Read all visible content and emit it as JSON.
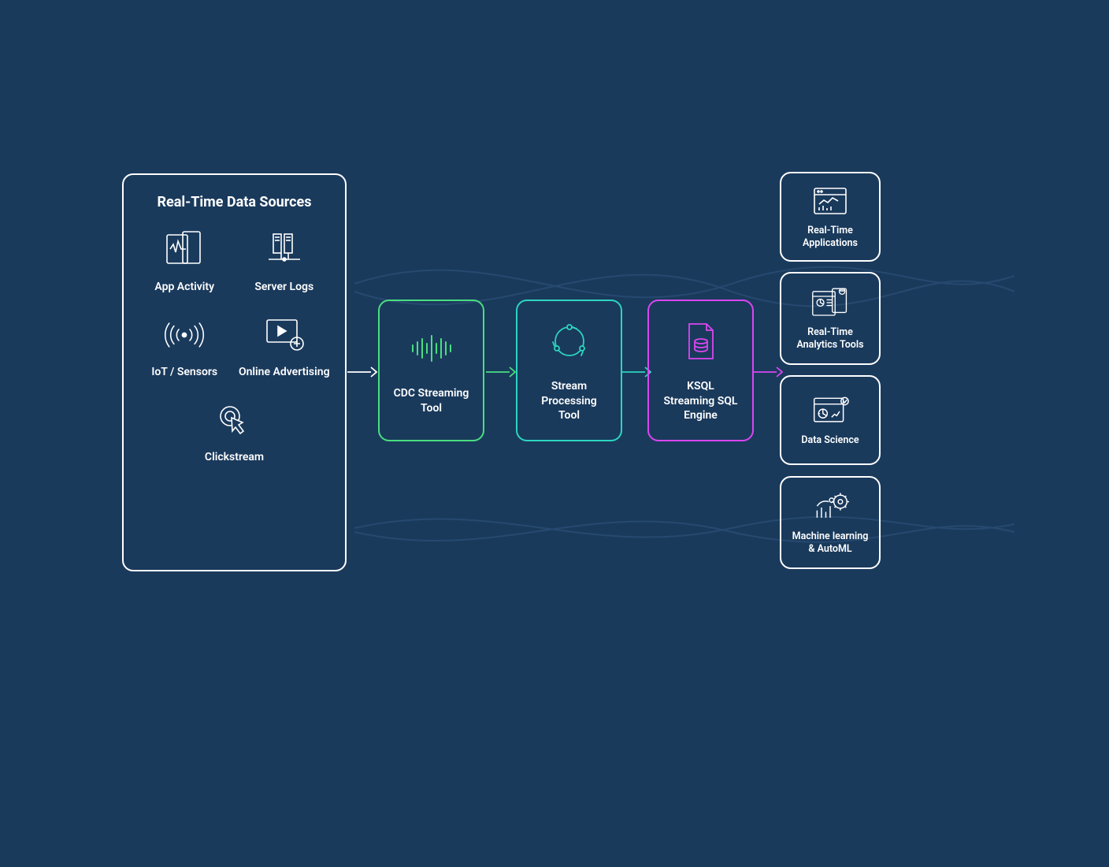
{
  "sources": {
    "title": "Real-Time Data Sources",
    "items": [
      {
        "label": "App Activity"
      },
      {
        "label": "Server Logs"
      },
      {
        "label": "IoT / Sensors"
      },
      {
        "label": "Online Advertising"
      },
      {
        "label": "Clickstream"
      }
    ]
  },
  "processors": [
    {
      "label": "CDC Streaming Tool",
      "color": "#4ade80"
    },
    {
      "label": "Stream Processing Tool",
      "color": "#2dd4bf"
    },
    {
      "label": "KSQL Streaming SQL Engine",
      "color": "#d946ef"
    }
  ],
  "outputs": [
    {
      "label": "Real-Time Applications"
    },
    {
      "label": "Real-Time Analytics Tools"
    },
    {
      "label": "Data Science"
    },
    {
      "label": "Machine learning & AutoML"
    }
  ]
}
